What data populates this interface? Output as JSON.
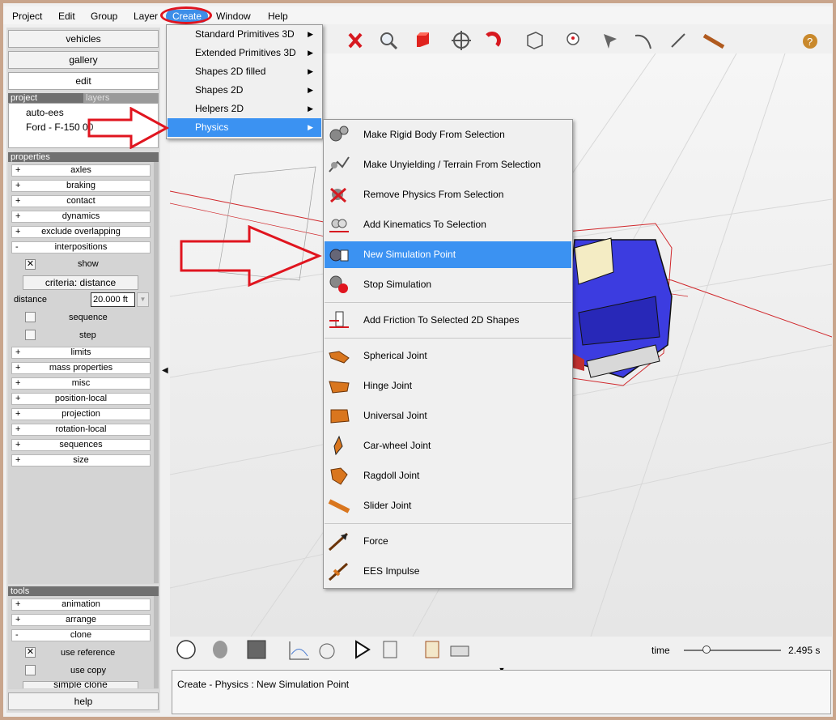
{
  "menubar": {
    "items": [
      "Project",
      "Edit",
      "Group",
      "Layer",
      "Create",
      "Window",
      "Help"
    ]
  },
  "left_panel": {
    "top_buttons": [
      "vehicles",
      "gallery",
      "edit"
    ],
    "project_tabs": [
      "project",
      "layers"
    ],
    "project_items": [
      "auto-ees",
      "Ford - F-150 00"
    ],
    "properties_header": "properties",
    "properties": [
      {
        "sign": "+",
        "label": "axles"
      },
      {
        "sign": "+",
        "label": "braking"
      },
      {
        "sign": "+",
        "label": "contact"
      },
      {
        "sign": "+",
        "label": "dynamics"
      },
      {
        "sign": "+",
        "label": "exclude overlapping"
      },
      {
        "sign": "-",
        "label": "interpositions"
      }
    ],
    "interpositions": {
      "show_label": "show",
      "show_checked": "✕",
      "criteria_button": "criteria: distance",
      "distance_label": "distance",
      "distance_value": "20.000 ft",
      "sequence_label": "sequence",
      "step_label": "step"
    },
    "properties_more": [
      {
        "sign": "+",
        "label": "limits"
      },
      {
        "sign": "+",
        "label": "mass properties"
      },
      {
        "sign": "+",
        "label": "misc"
      },
      {
        "sign": "+",
        "label": "position-local"
      },
      {
        "sign": "+",
        "label": "projection"
      },
      {
        "sign": "+",
        "label": "rotation-local"
      },
      {
        "sign": "+",
        "label": "sequences"
      },
      {
        "sign": "+",
        "label": "size"
      }
    ],
    "tools_header": "tools",
    "tools": [
      {
        "sign": "+",
        "label": "animation"
      },
      {
        "sign": "+",
        "label": "arrange"
      },
      {
        "sign": "-",
        "label": "clone"
      }
    ],
    "clone": {
      "use_reference_label": "use reference",
      "use_reference_checked": "✕",
      "use_copy_label": "use copy",
      "simple_clone_label": "simple clone"
    },
    "help_button": "help"
  },
  "create_menu": {
    "items": [
      "Standard Primitives 3D",
      "Extended Primitives 3D",
      "Shapes 2D filled",
      "Shapes 2D",
      "Helpers 2D",
      "Physics"
    ],
    "highlighted": "Physics"
  },
  "physics_menu": {
    "groups": [
      [
        {
          "label": "Make Rigid Body From Selection",
          "icon": "gears-icon"
        },
        {
          "label": "Make Unyielding / Terrain From Selection",
          "icon": "terrain-icon"
        },
        {
          "label": "Remove Physics From Selection",
          "icon": "remove-physics-icon"
        },
        {
          "label": "Add Kinematics To Selection",
          "icon": "kinematics-icon"
        },
        {
          "label": "New Simulation Point",
          "icon": "simulation-point-icon"
        },
        {
          "label": "Stop Simulation",
          "icon": "stop-simulation-icon"
        }
      ],
      [
        {
          "label": "Add Friction To Selected 2D Shapes",
          "icon": "friction-icon"
        }
      ],
      [
        {
          "label": "Spherical Joint",
          "icon": "spherical-joint-icon"
        },
        {
          "label": "Hinge Joint",
          "icon": "hinge-joint-icon"
        },
        {
          "label": "Universal Joint",
          "icon": "universal-joint-icon"
        },
        {
          "label": "Car-wheel Joint",
          "icon": "car-wheel-joint-icon"
        },
        {
          "label": "Ragdoll Joint",
          "icon": "ragdoll-joint-icon"
        },
        {
          "label": "Slider Joint",
          "icon": "slider-joint-icon"
        }
      ],
      [
        {
          "label": "Force",
          "icon": "force-icon"
        },
        {
          "label": "EES Impulse",
          "icon": "ees-impulse-icon"
        }
      ]
    ],
    "highlighted": "New Simulation Point"
  },
  "timebar": {
    "label": "time",
    "value": "2.495 s",
    "slider_fraction": 0.23
  },
  "status": {
    "text": "Create - Physics : New Simulation Point"
  },
  "colors": {
    "highlight": "#3b92f2",
    "annotation_red": "#e0151f",
    "car_blue": "#3c3ce0"
  }
}
